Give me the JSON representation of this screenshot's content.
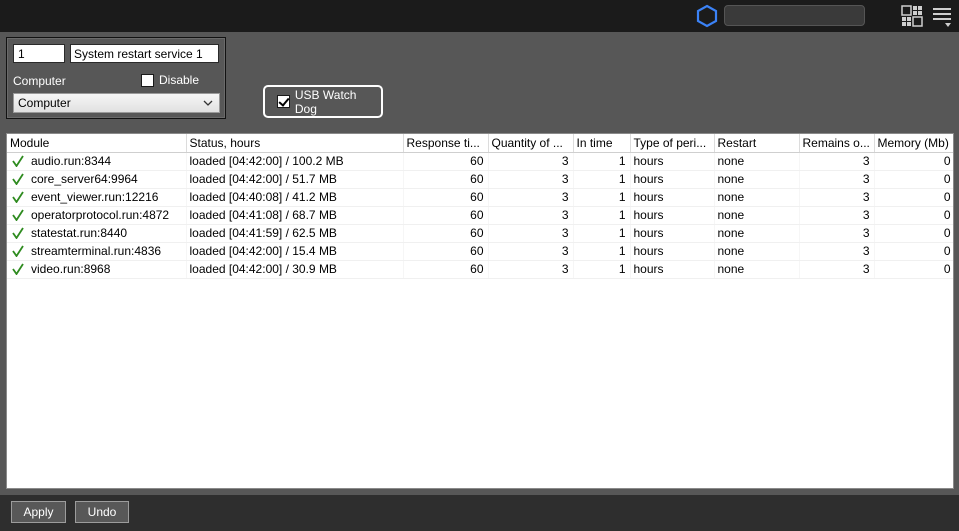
{
  "topbar": {
    "search_value": "",
    "icons": [
      "hexagon-icon",
      "layout-icon",
      "menu-icon"
    ],
    "accent_color": "#3b82f6"
  },
  "settings": {
    "id_value": "1",
    "name_value": "System restart service 1",
    "computer_label": "Computer",
    "disable_label": "Disable",
    "disable_checked": false,
    "computer_select_value": "Computer"
  },
  "usb_watchdog": {
    "label": "USB Watch Dog",
    "checked": true
  },
  "table": {
    "columns": [
      "Module",
      "Status, hours",
      "Response ti...",
      "Quantity of ...",
      "In time",
      "Type of peri...",
      "Restart",
      "Remains o...",
      "Memory (Mb)"
    ],
    "rows": [
      [
        "audio.run:8344",
        "loaded [04:42:00] / 100.2 MB",
        "60",
        "3",
        "1",
        "hours",
        "none",
        "3",
        "0"
      ],
      [
        "core_server64:9964",
        "loaded [04:42:00] / 51.7 MB",
        "60",
        "3",
        "1",
        "hours",
        "none",
        "3",
        "0"
      ],
      [
        "event_viewer.run:12216",
        "loaded [04:40:08] / 41.2 MB",
        "60",
        "3",
        "1",
        "hours",
        "none",
        "3",
        "0"
      ],
      [
        "operatorprotocol.run:4872",
        "loaded [04:41:08] / 68.7 MB",
        "60",
        "3",
        "1",
        "hours",
        "none",
        "3",
        "0"
      ],
      [
        "statestat.run:8440",
        "loaded [04:41:59] / 62.5 MB",
        "60",
        "3",
        "1",
        "hours",
        "none",
        "3",
        "0"
      ],
      [
        "streamterminal.run:4836",
        "loaded [04:42:00] / 15.4 MB",
        "60",
        "3",
        "1",
        "hours",
        "none",
        "3",
        "0"
      ],
      [
        "video.run:8968",
        "loaded [04:42:00] / 30.9 MB",
        "60",
        "3",
        "1",
        "hours",
        "none",
        "3",
        "0"
      ]
    ],
    "status_icon": "check-icon",
    "status_color": "#2e8b1f"
  },
  "footer": {
    "apply_label": "Apply",
    "undo_label": "Undo"
  }
}
